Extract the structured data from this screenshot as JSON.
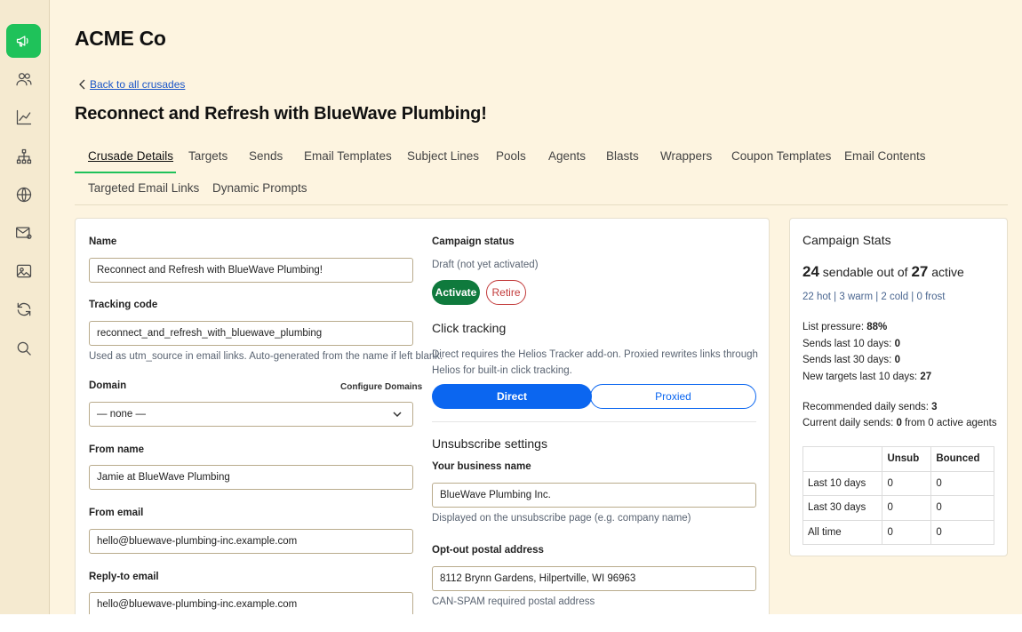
{
  "company": "ACME Co",
  "sidebar": {
    "items": [
      {
        "icon": "megaphone-icon",
        "active": true
      },
      {
        "icon": "users-icon",
        "active": false
      },
      {
        "icon": "chart-icon",
        "active": false
      },
      {
        "icon": "sitemap-icon",
        "active": false
      },
      {
        "icon": "globe-icon",
        "active": false
      },
      {
        "icon": "mail-at-icon",
        "active": false
      },
      {
        "icon": "image-icon",
        "active": false
      },
      {
        "icon": "refresh-icon",
        "active": false
      },
      {
        "icon": "search-icon",
        "active": false
      }
    ]
  },
  "back_link": "Back to all crusades",
  "page_title": "Reconnect and Refresh with BlueWave Plumbing!",
  "tabs": [
    "Crusade Details",
    "Targets",
    "Sends",
    "Email Templates",
    "Subject Lines",
    "Pools",
    "Agents",
    "Blasts",
    "Wrappers",
    "Coupon Templates",
    "Email Contents",
    "Targeted Email Links",
    "Dynamic Prompts"
  ],
  "active_tab": "Crusade Details",
  "form": {
    "name_label": "Name",
    "name_value": "Reconnect and Refresh with BlueWave Plumbing!",
    "tracking_label": "Tracking code",
    "tracking_value": "reconnect_and_refresh_with_bluewave_plumbing",
    "tracking_help": "Used as utm_source in email links. Auto-generated from the name if left blank.",
    "domain_label": "Domain",
    "configure_domains": "Configure Domains",
    "domain_value": "— none —",
    "from_name_label": "From name",
    "from_name_value": "Jamie at BlueWave Plumbing",
    "from_email_label": "From email",
    "from_email_value": "hello@bluewave-plumbing-inc.example.com",
    "reply_to_label": "Reply-to email",
    "reply_to_value": "hello@bluewave-plumbing-inc.example.com"
  },
  "campaign": {
    "status_label": "Campaign status",
    "status_text": "Draft (not yet activated)",
    "activate_label": "Activate",
    "retire_label": "Retire",
    "click_tracking_title": "Click tracking",
    "click_tracking_help_1": "Direct requires the Helios Tracker add-on. Proxied rewrites links through",
    "click_tracking_help_2": "Helios for built-in click tracking.",
    "direct_label": "Direct",
    "proxied_label": "Proxied",
    "selected_tracking": "Direct",
    "unsub_title": "Unsubscribe settings",
    "business_label": "Your business name",
    "business_value": "BlueWave Plumbing Inc.",
    "business_help": "Displayed on the unsubscribe page (e.g. company name)",
    "postal_label": "Opt-out postal address",
    "postal_value": "8112 Brynn Gardens, Hilpertville, WI 96963",
    "postal_help": "CAN-SPAM required postal address"
  },
  "stats": {
    "title": "Campaign Stats",
    "sendable": "24",
    "sendable_text": " sendable out of ",
    "active": "27",
    "active_text": " active",
    "temps": "22 hot | 3 warm | 2 cold | 0 frost",
    "list_pressure_label": "List pressure: ",
    "list_pressure": "88%",
    "sends_10_label": "Sends last 10 days: ",
    "sends_10": "0",
    "sends_30_label": "Sends last 30 days: ",
    "sends_30": "0",
    "new_targets_label": "New targets last 10 days: ",
    "new_targets": "27",
    "rec_daily_label": "Recommended daily sends: ",
    "rec_daily": "3",
    "cur_daily_label": "Current daily sends: ",
    "cur_daily": "0",
    "cur_daily_suffix": " from 0 active agents",
    "table_headers": [
      "",
      "Unsub",
      "Bounced"
    ],
    "table_rows": [
      [
        "Last 10 days",
        "0",
        "0"
      ],
      [
        "Last 30 days",
        "0",
        "0"
      ],
      [
        "All time",
        "0",
        "0"
      ]
    ]
  }
}
